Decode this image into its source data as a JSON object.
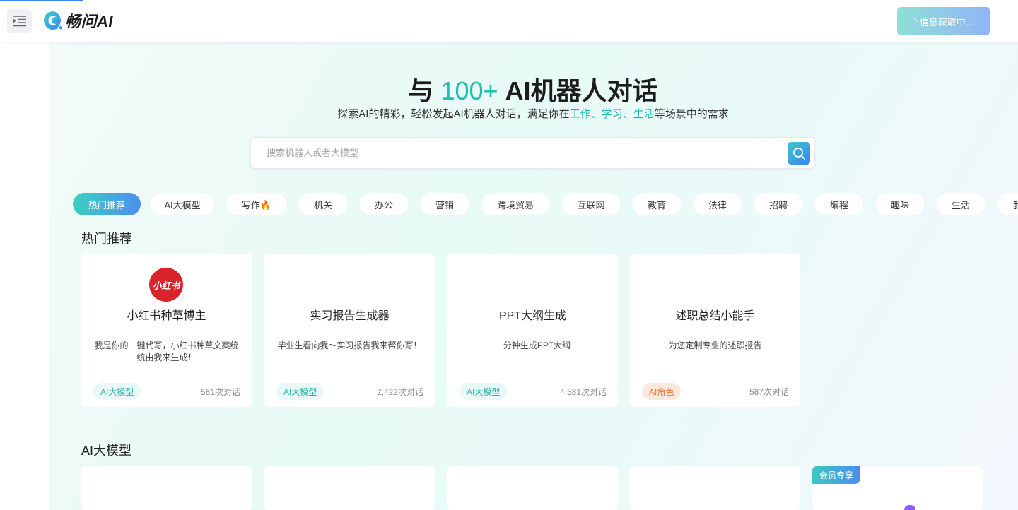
{
  "header": {
    "logo_text": "畅问AI",
    "status_button_label": "信息获取中..."
  },
  "hero": {
    "title_prefix": "与",
    "title_accent": "100+",
    "title_suffix": "AI机器人对话",
    "subtitle_prefix": "探索AI的精彩，轻松发起AI机器人对话，满足你在",
    "subtitle_hl1": "工作",
    "subtitle_sep1": "、",
    "subtitle_hl2": "学习",
    "subtitle_sep2": "、",
    "subtitle_hl3": "生活",
    "subtitle_suffix": "等场景中的需求"
  },
  "search": {
    "placeholder": "搜索机器人或者大模型",
    "value": ""
  },
  "tabs": [
    {
      "label": "热门推荐",
      "active": true
    },
    {
      "label": "AI大模型"
    },
    {
      "label": "写作🔥"
    },
    {
      "label": "机关"
    },
    {
      "label": "办公"
    },
    {
      "label": "营销"
    },
    {
      "label": "跨境贸易"
    },
    {
      "label": "互联网"
    },
    {
      "label": "教育"
    },
    {
      "label": "法律"
    },
    {
      "label": "招聘"
    },
    {
      "label": "编程"
    },
    {
      "label": "趣味"
    },
    {
      "label": "生活"
    },
    {
      "label": "我的收藏"
    }
  ],
  "sections": {
    "hot_title": "热门推荐",
    "llm_title": "AI大模型"
  },
  "hot_cards": [
    {
      "avatar_text": "小红书",
      "name": "小红书种草博主",
      "desc": "我是你的一键代写，小红书种草文案统统由我来生成！",
      "tag": "AI大模型",
      "count": "581次对话"
    },
    {
      "name": "实习报告生成器",
      "desc": "毕业生看向我～实习报告我来帮你写！",
      "tag": "AI大模型",
      "count": "2,422次对话"
    },
    {
      "name": "PPT大纲生成",
      "desc": "一分钟生成PPT大纲",
      "tag": "AI大模型",
      "count": "4,581次对话"
    },
    {
      "name": "述职总结小能手",
      "desc": "为您定制专业的述职报告",
      "tag": "AI角色",
      "count": "587次对话"
    }
  ],
  "llm_cards": {
    "member_badge": "会员专享"
  },
  "colors": {
    "accent": "#20c0b0",
    "brand_blue": "#3b82f6",
    "xhs_red": "#d8232a"
  }
}
